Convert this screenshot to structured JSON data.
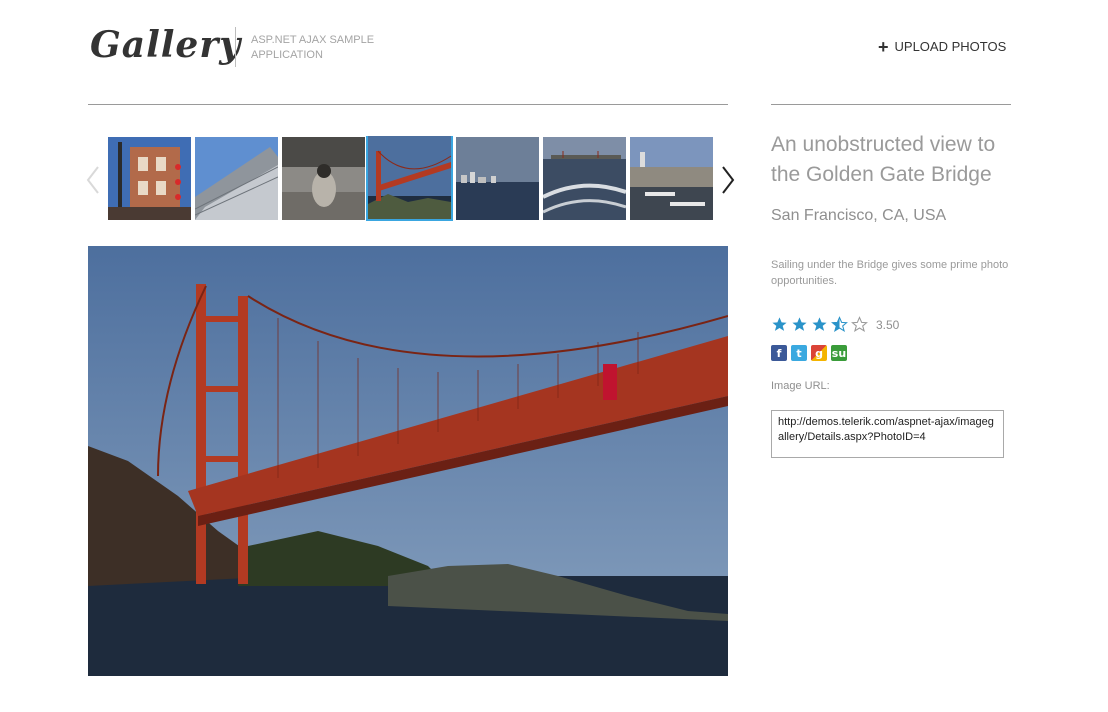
{
  "header": {
    "logo": "Gallery",
    "subtitle_line1": "ASP.NET AJAX SAMPLE",
    "subtitle_line2": "APPLICATION",
    "upload_label": "UPLOAD PHOTOS"
  },
  "thumbnails": [
    {
      "scene": "building-street",
      "active": false
    },
    {
      "scene": "skyscraper",
      "active": false
    },
    {
      "scene": "sea-lion",
      "active": false
    },
    {
      "scene": "golden-gate-bridge",
      "active": true
    },
    {
      "scene": "city-skyline-water",
      "active": false
    },
    {
      "scene": "boat-wake",
      "active": false
    },
    {
      "scene": "marina-city",
      "active": false
    }
  ],
  "photo": {
    "title": "An unobstructed view to the Golden Gate Bridge",
    "location": "San Francisco, CA, USA",
    "description": "Sailing under the Bridge gives some prime photo opportunities.",
    "rating": 3.5,
    "rating_label": "3.50",
    "social": [
      "facebook-icon",
      "twitter-icon",
      "google-icon",
      "stumbleupon-icon"
    ],
    "url_label": "Image URL:",
    "url": "http://demos.telerik.com/aspnet-ajax/imagegallery/Details.aspx?PhotoID=4"
  },
  "colors": {
    "accent": "#3aa6e0",
    "star": "#2a93c9"
  }
}
